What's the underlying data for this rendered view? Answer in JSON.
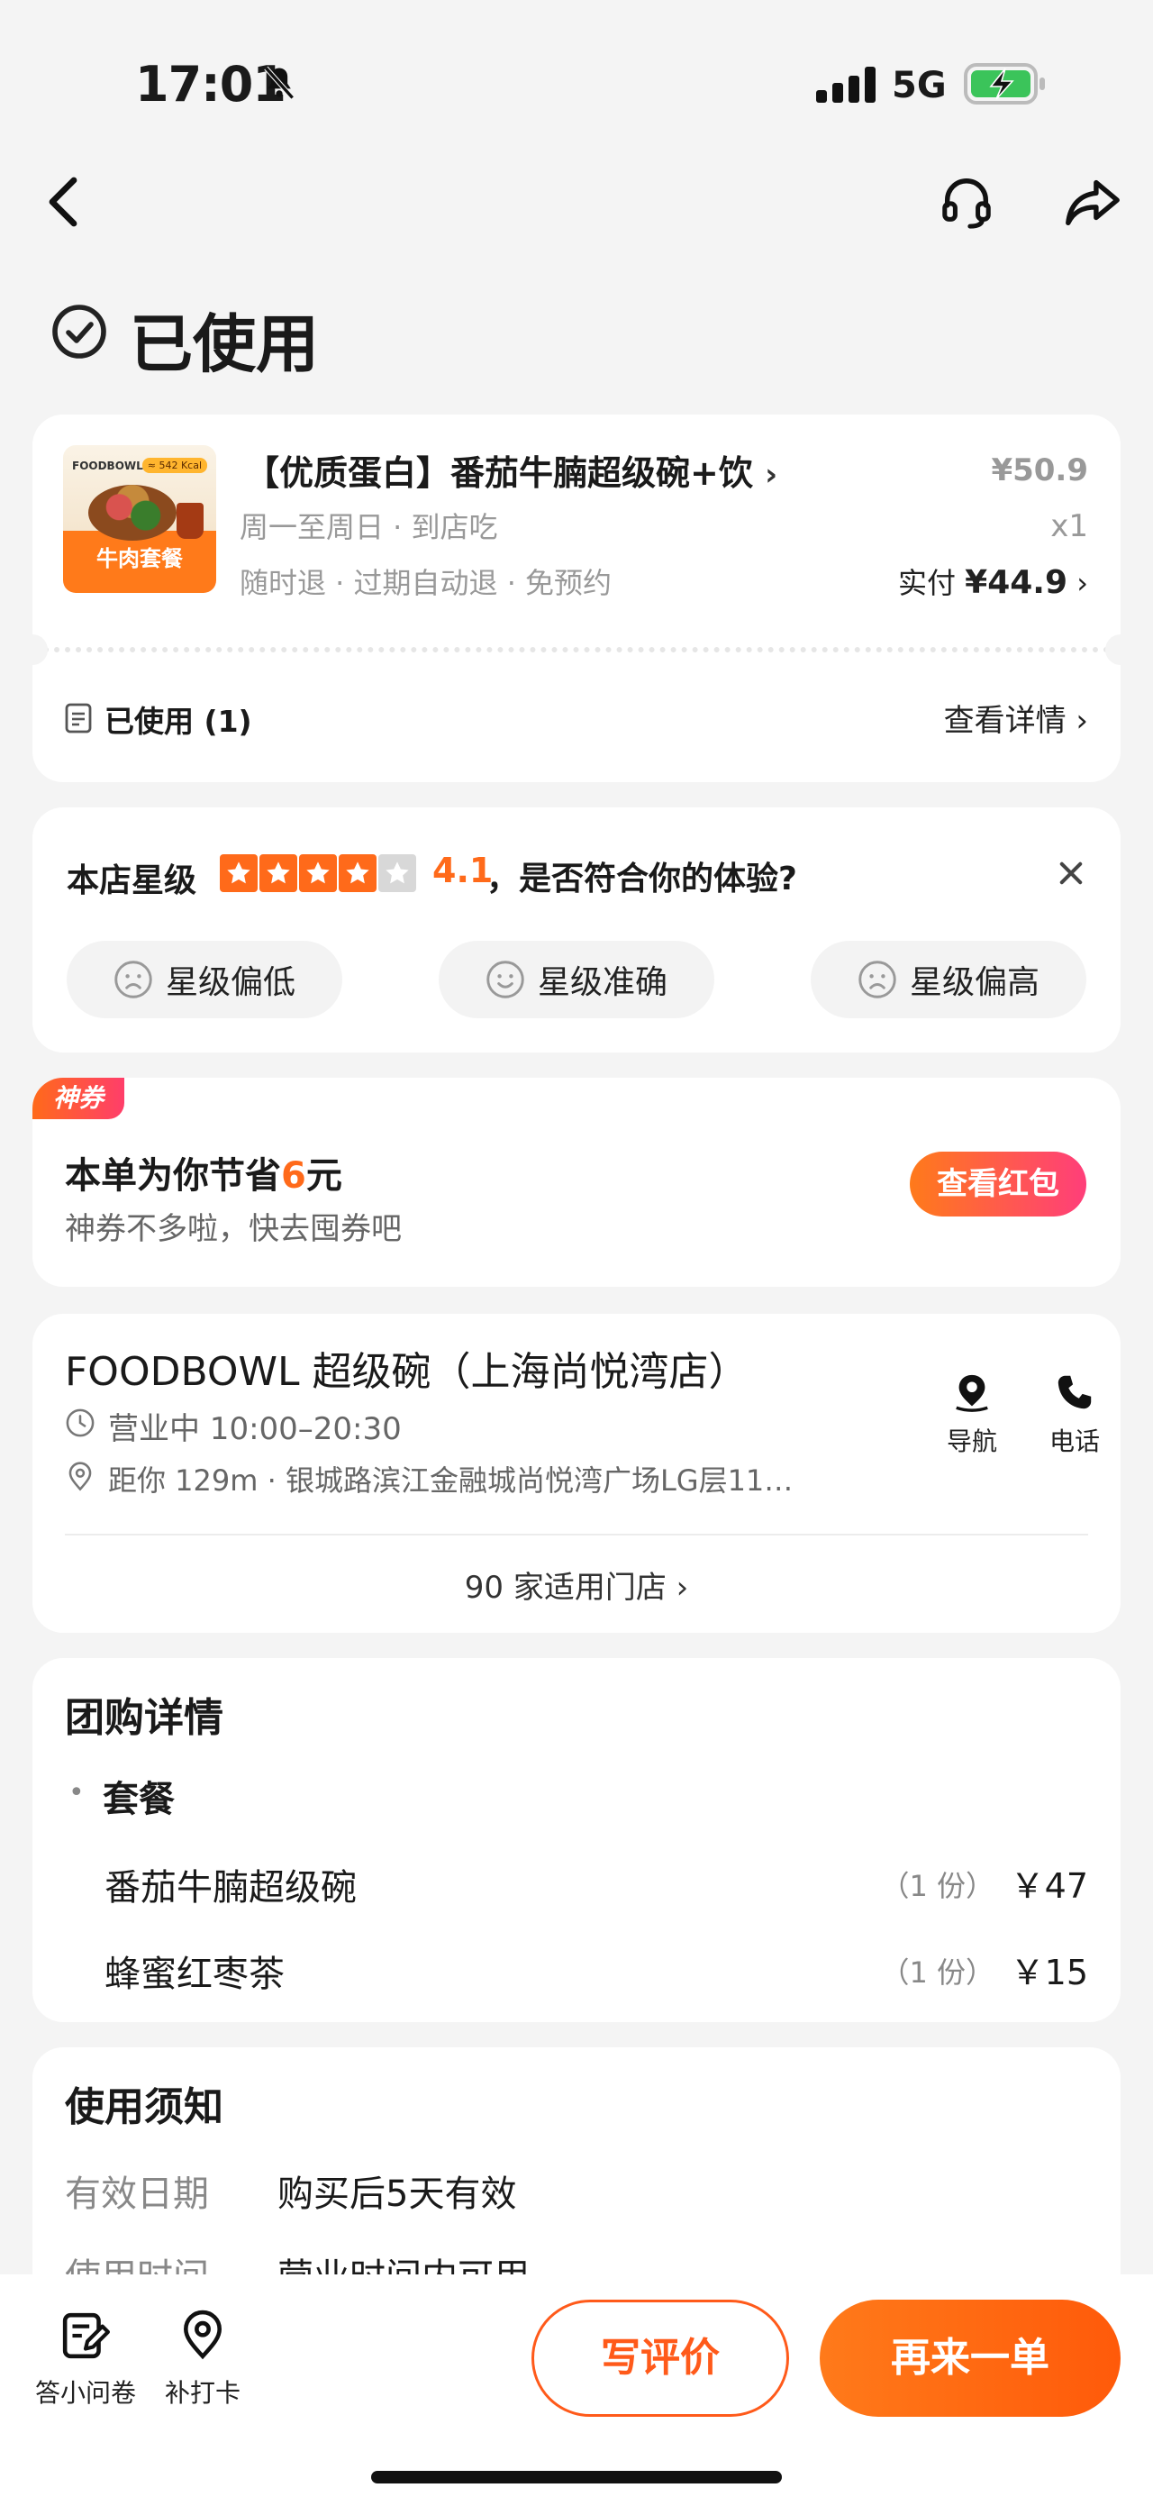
{
  "status_bar": {
    "time": "17:01",
    "network": "5G"
  },
  "page": {
    "status_title": "已使用"
  },
  "order": {
    "thumb_brand": "FOODBOWL",
    "thumb_kcal": "≈ 542 Kcal",
    "thumb_label": "牛肉套餐",
    "title": "【优质蛋白】番茄牛腩超级碗+饮",
    "price": "¥50.9",
    "line1": "周一至周日 · 到店吃",
    "line2": "随时退 · 过期自动退 · 免预约",
    "qty": "x1",
    "paid_label": "实付",
    "paid_amount": "¥44.9",
    "used_label": "已使用 (1)",
    "detail_link": "查看详情"
  },
  "rating": {
    "label": "本店星级",
    "score": "4.1",
    "stars_filled": 4,
    "stars_total": 5,
    "question": "，是否符合你的体验?",
    "options": [
      "星级偏低",
      "星级准确",
      "星级偏高"
    ]
  },
  "coupon": {
    "tag": "神券",
    "save_prefix": "本单为你节省",
    "save_amount": "6",
    "save_suffix": "元",
    "sub": "神券不多啦，快去囤券吧",
    "button": "查看红包"
  },
  "store": {
    "name": "FOODBOWL 超级碗（上海尚悦湾店）",
    "hours": "营业中 10:00–20:30",
    "address": "距你 129m ·  银城路滨江金融城尚悦湾广场LG层11…",
    "nav_label": "导航",
    "tel_label": "电话",
    "stores_link": "90 家适用门店"
  },
  "group_detail": {
    "title": "团购详情",
    "package_label": "套餐",
    "items": [
      {
        "name": "番茄牛腩超级碗",
        "count": "（1 份）",
        "price": "￥47"
      },
      {
        "name": "蜂蜜红枣茶",
        "count": "（1 份）",
        "price": "￥15"
      }
    ]
  },
  "notice": {
    "title": "使用须知",
    "rows": [
      {
        "key": "有效日期",
        "value": "购买后5天有效"
      },
      {
        "key": "使用时间",
        "value": "营业时间内可用"
      }
    ]
  },
  "bottom_bar": {
    "survey_label": "答小问卷",
    "checkin_label": "补打卡",
    "review_button": "写评价",
    "reorder_button": "再来一单"
  },
  "colors": {
    "accent": "#ff6a1a",
    "page_bg": "#f4f4f4",
    "card_bg": "#ffffff"
  }
}
